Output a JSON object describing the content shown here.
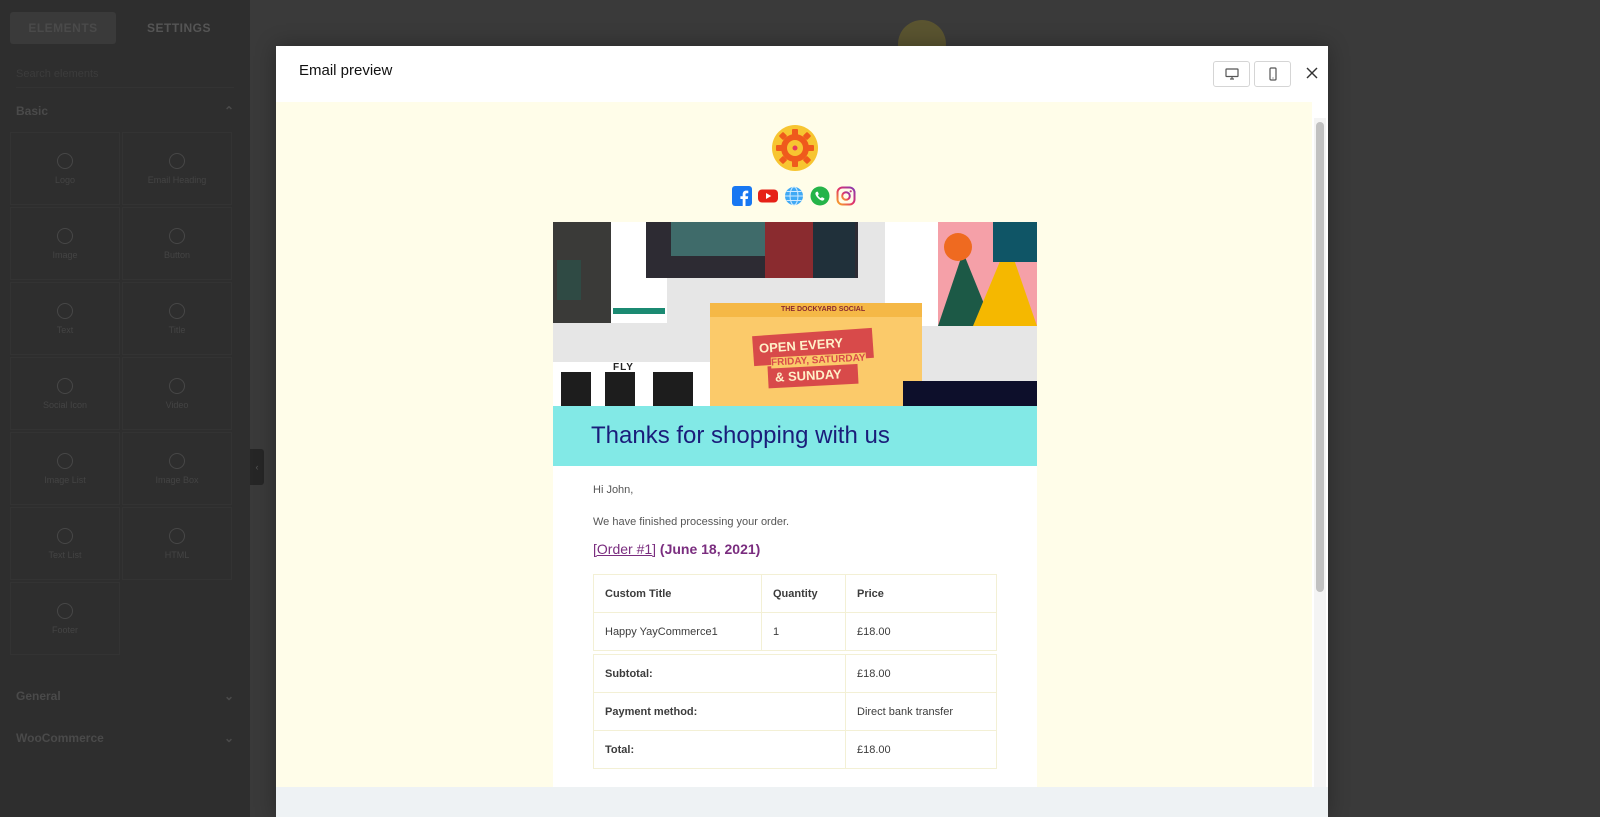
{
  "editor": {
    "tabs": [
      "ELEMENTS",
      "SETTINGS"
    ],
    "search_placeholder": "Search elements",
    "sections": [
      "Basic",
      "General",
      "WooCommerce"
    ],
    "elements": [
      "Logo",
      "Email Heading",
      "Image",
      "Button",
      "Text",
      "Title",
      "Social Icon",
      "Video",
      "Image List",
      "Image Box",
      "Text List",
      "HTML",
      "Footer"
    ]
  },
  "modal": {
    "title": "Email preview",
    "desktop_icon": "desktop-icon",
    "mobile_icon": "mobile-icon",
    "close_icon": "close-icon"
  },
  "email": {
    "logo_icon": "gear-logo-icon",
    "social_icons": [
      "facebook-icon",
      "youtube-icon",
      "globe-icon",
      "whatsapp-icon",
      "instagram-icon"
    ],
    "hero": {
      "fly": "FLY",
      "dockyard": "THE DOCKYARD SOCIAL",
      "open_line1": "OPEN EVERY",
      "open_line2": "FRIDAY, SATURDAY",
      "open_line3": "& SUNDAY"
    },
    "heading": "Thanks for shopping with us",
    "greeting": "Hi John,",
    "message": "We have finished processing your order.",
    "order_link": "[Order #1]",
    "order_date": "(June 18, 2021)",
    "table": {
      "headers": [
        "Custom Title",
        "Quantity",
        "Price"
      ],
      "items": [
        {
          "name": "Happy YayCommerce1",
          "qty": "1",
          "price": "£18.00"
        }
      ],
      "totals": [
        {
          "label": "Subtotal:",
          "value": "£18.00"
        },
        {
          "label": "Payment method:",
          "value": "Direct bank transfer"
        },
        {
          "label": "Total:",
          "value": "£18.00"
        }
      ]
    }
  },
  "colors": {
    "preview_bg": "#fffde9",
    "heading_bar": "#82e9e6",
    "heading_text": "#1a1d7a",
    "order_text": "#7a2d7f"
  }
}
